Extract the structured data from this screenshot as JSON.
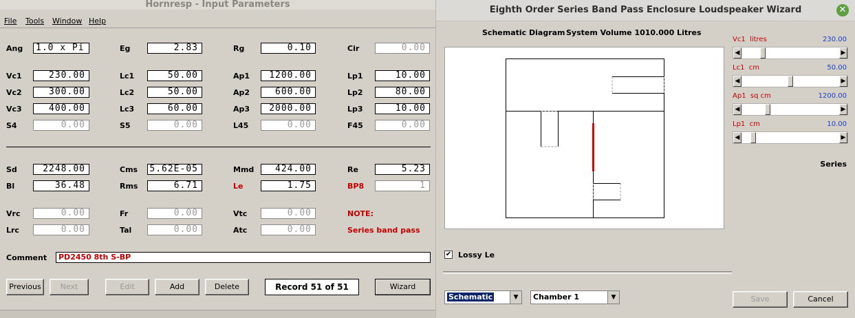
{
  "left_window": {
    "title": "Hornresp - Input Parameters",
    "menu": [
      "File",
      "Tools",
      "Window",
      "Help"
    ],
    "fields": {
      "ang": {
        "label": "Ang",
        "value": "1.0 x Pi"
      },
      "eg": {
        "label": "Eg",
        "value": "2.83"
      },
      "rg": {
        "label": "Rg",
        "value": "0.10"
      },
      "cir": {
        "label": "Cir",
        "value": "0.00"
      },
      "vc1": {
        "label": "Vc1",
        "value": "230.00"
      },
      "lc1": {
        "label": "Lc1",
        "value": "50.00"
      },
      "ap1": {
        "label": "Ap1",
        "value": "1200.00"
      },
      "lp1": {
        "label": "Lp1",
        "value": "10.00"
      },
      "vc2": {
        "label": "Vc2",
        "value": "300.00"
      },
      "lc2": {
        "label": "Lc2",
        "value": "50.00"
      },
      "ap2": {
        "label": "Ap2",
        "value": "600.00"
      },
      "lp2": {
        "label": "Lp2",
        "value": "80.00"
      },
      "vc3": {
        "label": "Vc3",
        "value": "400.00"
      },
      "lc3": {
        "label": "Lc3",
        "value": "60.00"
      },
      "ap3": {
        "label": "Ap3",
        "value": "2000.00"
      },
      "lp3": {
        "label": "Lp3",
        "value": "10.00"
      },
      "s4": {
        "label": "S4",
        "value": "0.00"
      },
      "s5": {
        "label": "S5",
        "value": "0.00"
      },
      "l45": {
        "label": "L45",
        "value": "0.00"
      },
      "f45": {
        "label": "F45",
        "value": "0.00"
      },
      "sd": {
        "label": "Sd",
        "value": "2248.00"
      },
      "cms": {
        "label": "Cms",
        "value": "5.62E-05"
      },
      "mmd": {
        "label": "Mmd",
        "value": "424.00"
      },
      "re": {
        "label": "Re",
        "value": "5.23"
      },
      "bl": {
        "label": "Bl",
        "value": "36.48"
      },
      "rms": {
        "label": "Rms",
        "value": "6.71"
      },
      "le": {
        "label": "Le",
        "value": "1.75"
      },
      "bp8": {
        "label": "BP8",
        "value": "1"
      },
      "vrc": {
        "label": "Vrc",
        "value": "0.00"
      },
      "fr": {
        "label": "Fr",
        "value": "0.00"
      },
      "vtc": {
        "label": "Vtc",
        "value": "0.00"
      },
      "lrc": {
        "label": "Lrc",
        "value": "0.00"
      },
      "tal": {
        "label": "Tal",
        "value": "0.00"
      },
      "atc": {
        "label": "Atc",
        "value": "0.00"
      }
    },
    "note_label": "NOTE:",
    "note_text": "Series band pass",
    "comment_label": "Comment",
    "comment_value": "PD2450 8th S-BP",
    "buttons": {
      "previous": "Previous",
      "next": "Next",
      "edit": "Edit",
      "add": "Add",
      "delete": "Delete",
      "wizard": "Wizard"
    },
    "record_text": "Record 51 of 51"
  },
  "right_window": {
    "title": "Eighth Order Series Band Pass Enclosure Loudspeaker Wizard",
    "schematic_title": "Schematic Diagram",
    "system_volume": "System Volume 1010.000 Litres",
    "sliders": [
      {
        "name": "Vc1",
        "unit": "litres",
        "value": "230.00",
        "fraction": 0.2
      },
      {
        "name": "Lc1",
        "unit": "cm",
        "value": "50.00",
        "fraction": 0.5
      },
      {
        "name": "Ap1",
        "unit": "sq cm",
        "value": "1200.00",
        "fraction": 0.25
      },
      {
        "name": "Lp1",
        "unit": "cm",
        "value": "10.00",
        "fraction": 0.1
      }
    ],
    "series_label": "Series",
    "lossy_le_label": "Lossy Le",
    "lossy_le_checked": true,
    "view_select": "Schematic",
    "chamber_select": "Chamber 1",
    "save_label": "Save",
    "cancel_label": "Cancel"
  },
  "colors": {
    "accent_red": "#c00000",
    "slider_value_blue": "#1a3fc8",
    "driver_red": "#e00000",
    "selected_blue": "#0a246a"
  }
}
